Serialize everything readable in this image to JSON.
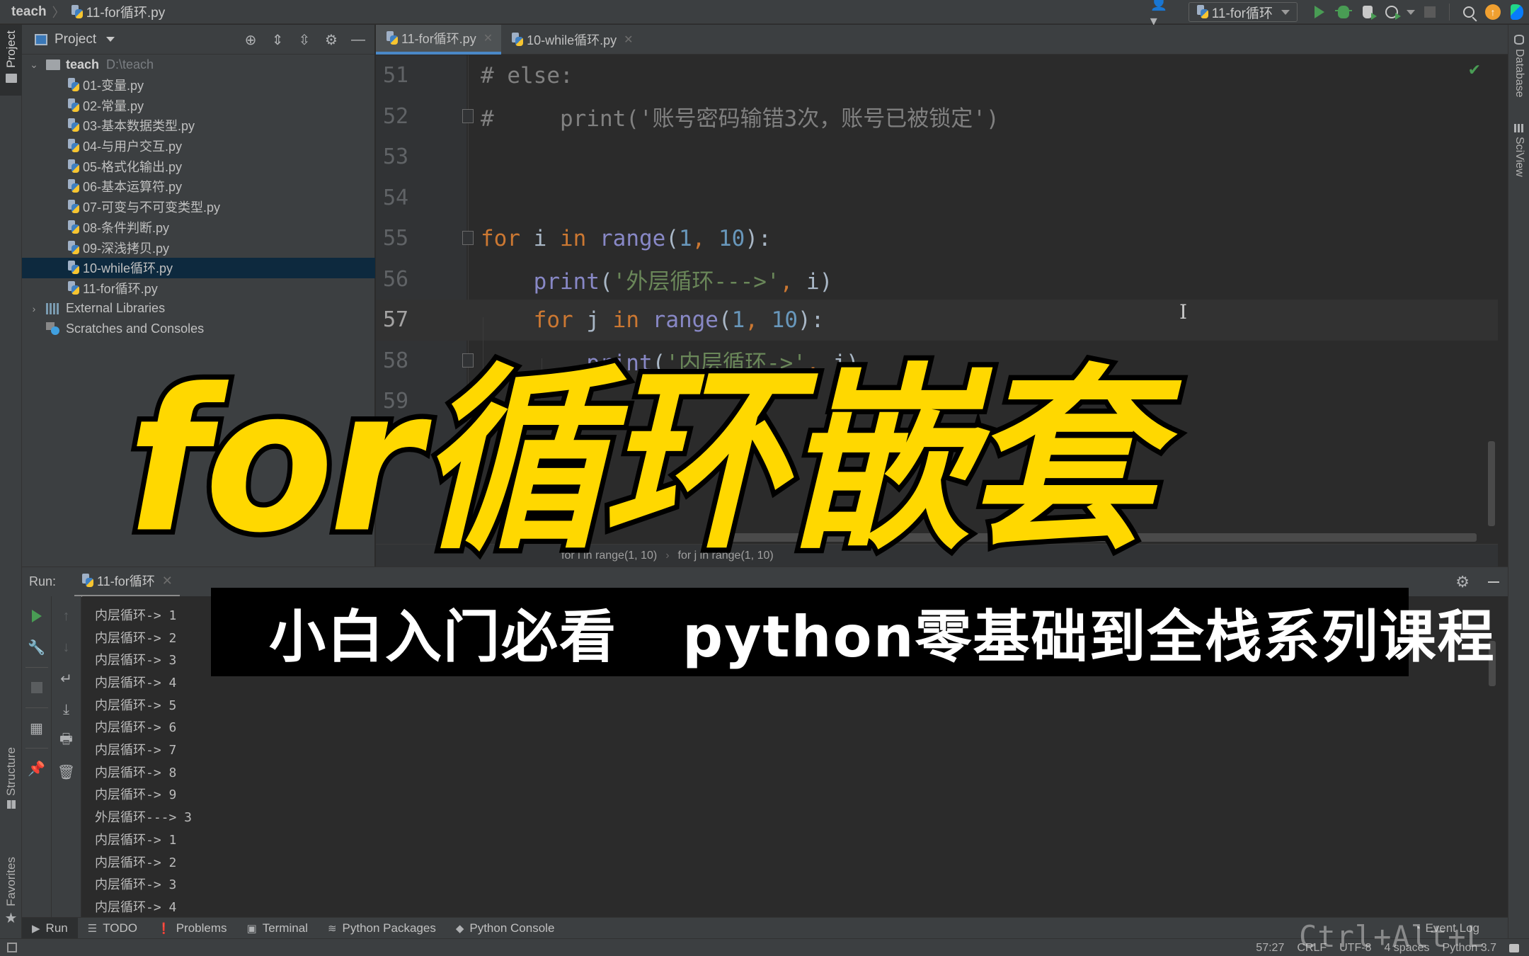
{
  "navbar": {
    "breadcrumb_root": "teach",
    "breadcrumb_file": "11-for循环.py",
    "run_config": "11-for循环",
    "update_badge": "↑"
  },
  "left_strip": {
    "project": "Project",
    "structure": "Structure",
    "favorites": "Favorites"
  },
  "right_strip": {
    "database": "Database",
    "sciview": "SciView"
  },
  "project_panel": {
    "title": "Project",
    "root": {
      "name": "teach",
      "path": "D:\\teach"
    },
    "files": [
      {
        "name": "01-变量.py",
        "selected": false
      },
      {
        "name": "02-常量.py",
        "selected": false
      },
      {
        "name": "03-基本数据类型.py",
        "selected": false
      },
      {
        "name": "04-与用户交互.py",
        "selected": false
      },
      {
        "name": "05-格式化输出.py",
        "selected": false
      },
      {
        "name": "06-基本运算符.py",
        "selected": false
      },
      {
        "name": "07-可变与不可变类型.py",
        "selected": false
      },
      {
        "name": "08-条件判断.py",
        "selected": false
      },
      {
        "name": "09-深浅拷贝.py",
        "selected": false
      },
      {
        "name": "10-while循环.py",
        "selected": true
      },
      {
        "name": "11-for循环.py",
        "selected": false
      }
    ],
    "external_libraries": "External Libraries",
    "scratches": "Scratches and Consoles"
  },
  "editor": {
    "tabs": [
      {
        "label": "11-for循环.py",
        "active": true
      },
      {
        "label": "10-while循环.py",
        "active": false
      }
    ],
    "lines": [
      {
        "num": "51",
        "tokens": [
          [
            "cm",
            "# else:"
          ]
        ]
      },
      {
        "num": "52",
        "tokens": [
          [
            "cm",
            "#     print('账号密码输错3次，账号已被锁定')"
          ]
        ]
      },
      {
        "num": "53",
        "tokens": []
      },
      {
        "num": "54",
        "tokens": []
      },
      {
        "num": "55",
        "tokens": [
          [
            "kw",
            "for"
          ],
          [
            "pl",
            " i "
          ],
          [
            "kw",
            "in"
          ],
          [
            "pl",
            " "
          ],
          [
            "fn",
            "range"
          ],
          [
            "pl",
            "("
          ],
          [
            "num",
            "1"
          ],
          [
            "kw",
            ","
          ],
          [
            "pl",
            " "
          ],
          [
            "num",
            "10"
          ],
          [
            "pl",
            "):"
          ]
        ]
      },
      {
        "num": "56",
        "tokens": [
          [
            "pl",
            "    "
          ],
          [
            "fn",
            "print"
          ],
          [
            "pl",
            "("
          ],
          [
            "str",
            "'外层循环--->'"
          ],
          [
            "kw",
            ","
          ],
          [
            "pl",
            " i)"
          ]
        ]
      },
      {
        "num": "57",
        "tokens": [
          [
            "pl",
            "    "
          ],
          [
            "kw",
            "for"
          ],
          [
            "pl",
            " j "
          ],
          [
            "kw",
            "in"
          ],
          [
            "pl",
            " "
          ],
          [
            "fn",
            "range"
          ],
          [
            "pl",
            "("
          ],
          [
            "num",
            "1"
          ],
          [
            "kw",
            ","
          ],
          [
            "pl",
            " "
          ],
          [
            "num",
            "10"
          ],
          [
            "pl",
            "):"
          ]
        ]
      },
      {
        "num": "58",
        "tokens": [
          [
            "pl",
            "        "
          ],
          [
            "fn",
            "print"
          ],
          [
            "pl",
            "("
          ],
          [
            "str",
            "'内层循环->'"
          ],
          [
            "kw",
            ","
          ],
          [
            "pl",
            " j)"
          ]
        ]
      },
      {
        "num": "59",
        "tokens": []
      }
    ],
    "current_line": "57",
    "breadcrumb": [
      "for i in range(1, 10)",
      "for j in range(1, 10)"
    ]
  },
  "run_panel": {
    "label": "Run:",
    "tab": "11-for循环",
    "output": [
      "内层循环-> 1",
      "内层循环-> 2",
      "内层循环-> 3",
      "内层循环-> 4",
      "内层循环-> 5",
      "内层循环-> 6",
      "内层循环-> 7",
      "内层循环-> 8",
      "内层循环-> 9",
      "外层循环---> 3",
      "内层循环-> 1",
      "内层循环-> 2",
      "内层循环-> 3",
      "内层循环-> 4"
    ]
  },
  "bottom_tabs": [
    {
      "label": "Run",
      "icon": "▶",
      "active": true
    },
    {
      "label": "TODO",
      "icon": "☰",
      "active": false
    },
    {
      "label": "Problems",
      "icon": "❗",
      "active": false
    },
    {
      "label": "Terminal",
      "icon": "▣",
      "active": false
    },
    {
      "label": "Python Packages",
      "icon": "≋",
      "active": false
    },
    {
      "label": "Python Console",
      "icon": "◆",
      "active": false
    }
  ],
  "event_log": "Event Log",
  "status": {
    "position": "57:27",
    "line_sep": "CRLF",
    "encoding": "UTF-8",
    "indent": "4 spaces",
    "interpreter": "Python 3.7"
  },
  "key_overlay": "Ctrl+Alt+L",
  "overlay": {
    "title": "for循环嵌套",
    "subtitle_left": "小白入门必看",
    "subtitle_right": "python零基础到全栈系列课程"
  },
  "colors": {
    "title_yellow": "#ffd800",
    "keyword": "#cc7832",
    "function": "#8888c6",
    "number": "#6897bb",
    "string": "#6a8759",
    "comment": "#808080",
    "selection": "#0d293e",
    "accent_blue": "#4a88c7",
    "run_green": "#499c54"
  }
}
